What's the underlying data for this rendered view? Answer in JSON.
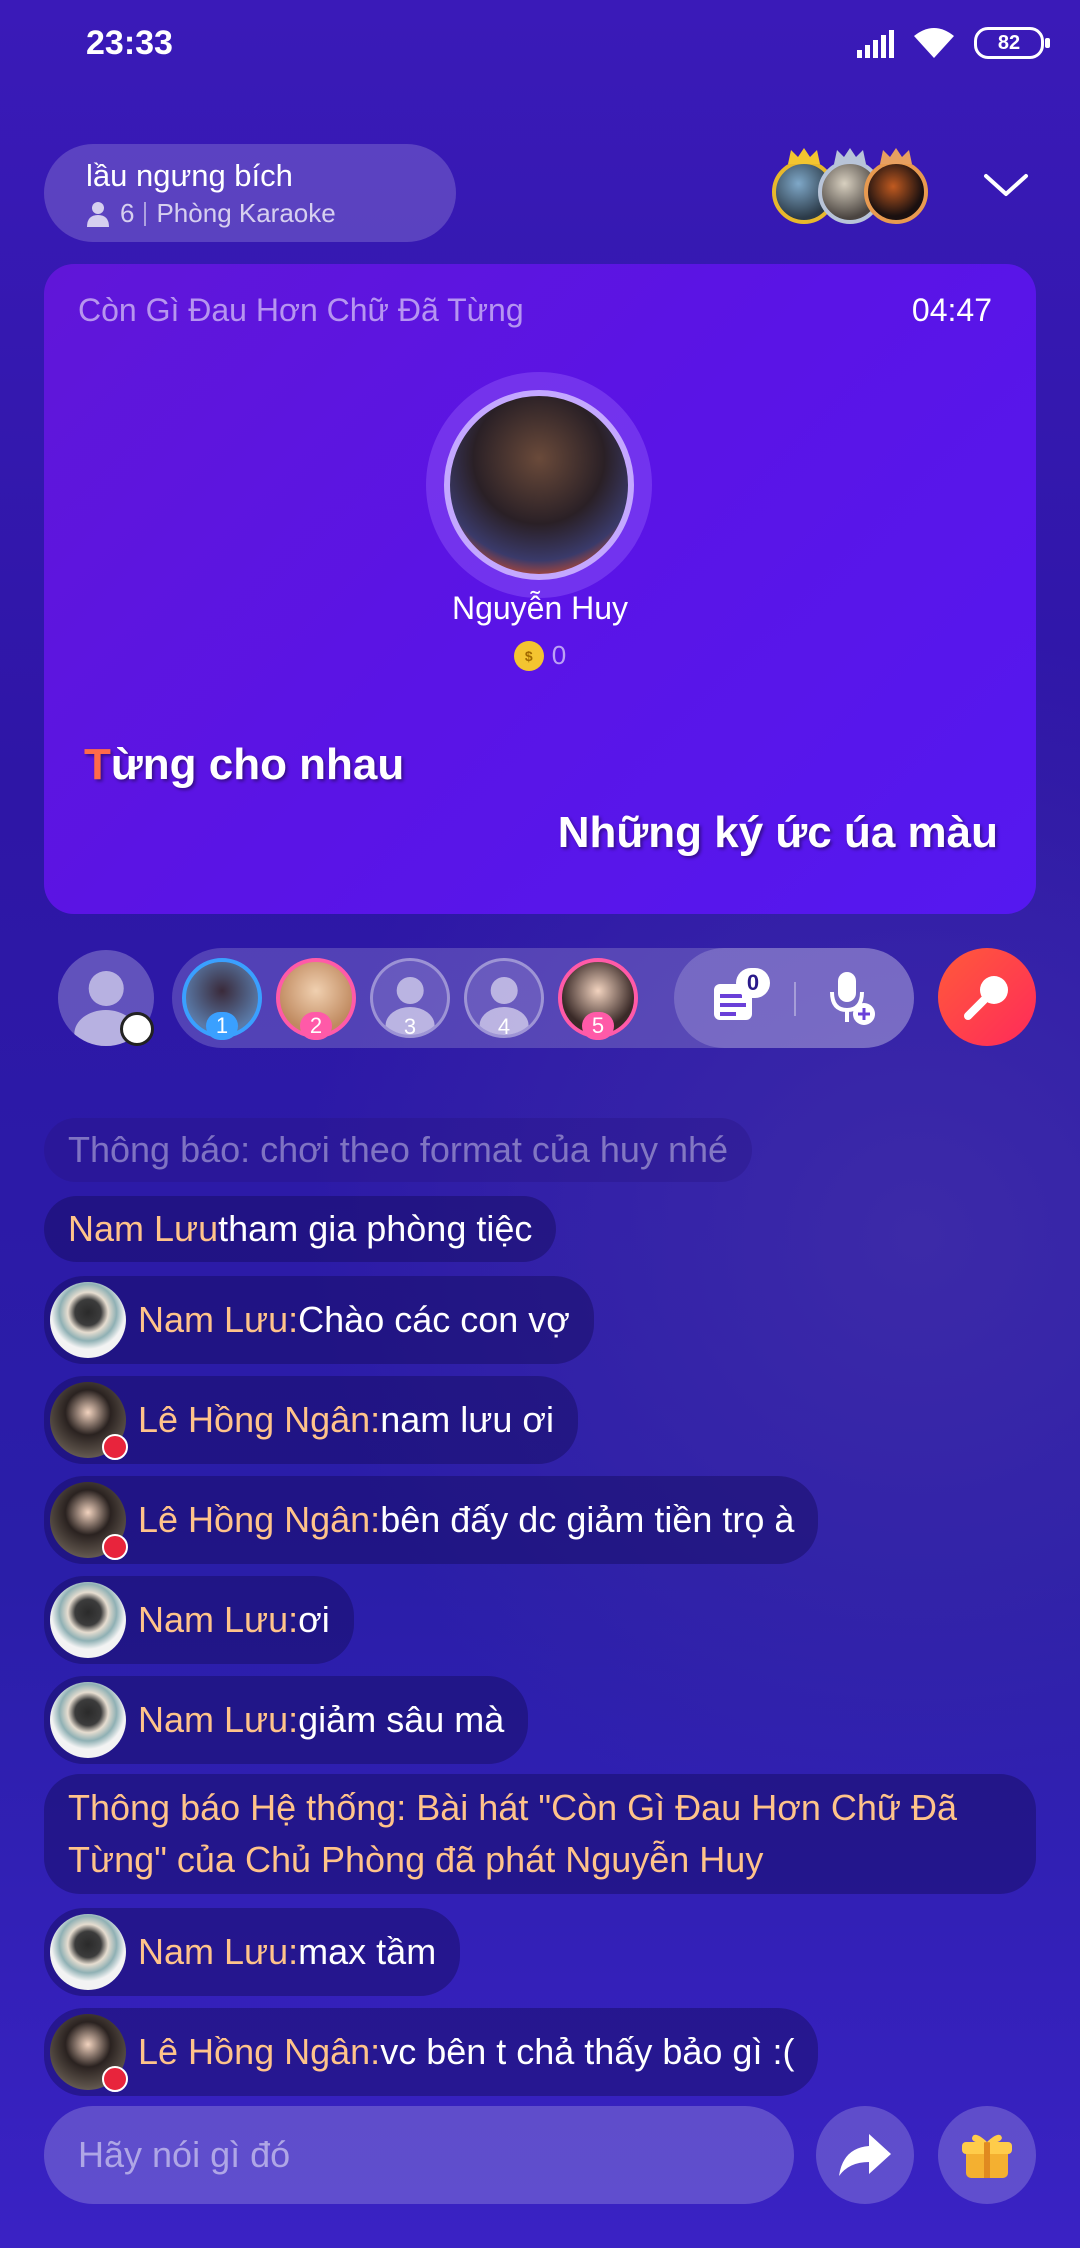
{
  "status_bar": {
    "time": "23:33",
    "battery": "82"
  },
  "room": {
    "name": "lầu ngưng bích",
    "members": "6",
    "type": "Phòng Karaoke"
  },
  "song": {
    "title": "Còn Gì Đau Hơn Chữ Đã Từng",
    "time": "04:47",
    "singer": "Nguyễn Huy",
    "coins": "0",
    "lyric_1_first": "T",
    "lyric_1_rest": "ừng cho nhau",
    "lyric_2": "Những ký ức úa màu"
  },
  "queue": {
    "slots": [
      "1",
      "2",
      "3",
      "4",
      "5"
    ],
    "song_count": "0"
  },
  "chat": [
    {
      "type": "notice",
      "text": "Thông báo: chơi theo format của huy nhé"
    },
    {
      "type": "join",
      "who": "Nam Lưu",
      "text": " tham gia phòng tiệc"
    },
    {
      "type": "msg",
      "who": "Nam Lưu:",
      "text": " Chào các con vợ"
    },
    {
      "type": "msg",
      "who": "Lê Hồng Ngân:",
      "text": " nam lưu ơi"
    },
    {
      "type": "msg",
      "who": "Lê Hồng Ngân:",
      "text": " bên đấy dc giảm tiền trọ à"
    },
    {
      "type": "msg",
      "who": "Nam Lưu:",
      "text": " ơi"
    },
    {
      "type": "msg",
      "who": "Nam Lưu:",
      "text": " giảm sâu mà"
    },
    {
      "type": "system",
      "line1": "Thông báo Hệ thống: Bài hát \"Còn Gì Đau Hơn Chữ Đã",
      "line2": "Từng\" của Chủ Phòng đã phát Nguyễn Huy"
    },
    {
      "type": "msg",
      "who": "Nam Lưu:",
      "text": " max tầm"
    },
    {
      "type": "msg",
      "who": "Lê Hồng Ngân:",
      "text": " vc bên t chả thấy bảo gì :("
    }
  ],
  "input": {
    "placeholder": "Hãy nói gì đó"
  },
  "colors": {
    "accent": "#ff4a3a",
    "name": "#ffc38a",
    "card": "#5a14e6"
  }
}
